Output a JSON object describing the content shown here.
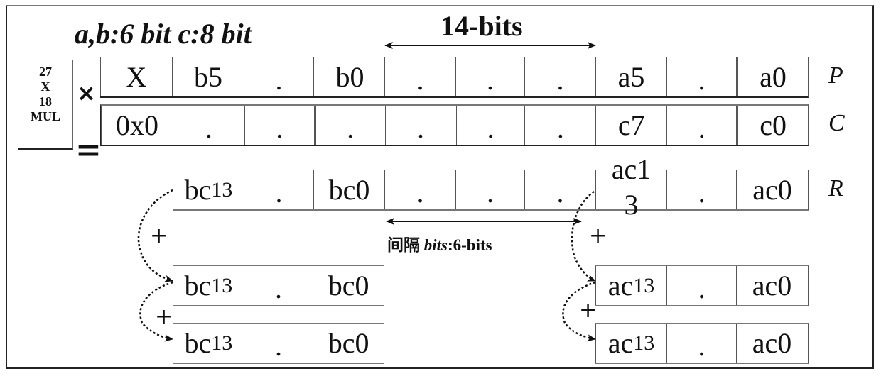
{
  "title": "a,b:6 bit c:8 bit",
  "span_label": "14-bits",
  "multiplier": {
    "lines": [
      "27",
      "X",
      "18",
      "MUL"
    ]
  },
  "operators": {
    "times": "×",
    "equals": "=",
    "plus": "+"
  },
  "rows": {
    "P": {
      "label": "P",
      "cells": [
        "X",
        "b5",
        ".",
        "b0",
        ".",
        ".",
        ".",
        "a5",
        ".",
        "a0"
      ]
    },
    "C": {
      "label": "C",
      "cells": [
        "0x0",
        ".",
        ".",
        ".",
        ".",
        ".",
        ".",
        "c7",
        ".",
        "c0"
      ]
    },
    "R": {
      "label": "R",
      "cells": [
        {
          "main": "bc",
          "sub": "13"
        },
        {
          "main": "."
        },
        {
          "main": "bc0"
        },
        {
          "main": "."
        },
        {
          "main": "."
        },
        {
          "main": "."
        },
        {
          "main": "ac1\n3"
        },
        {
          "main": "."
        },
        {
          "main": "ac0"
        }
      ]
    }
  },
  "gap_label": {
    "prefix": "间隔 ",
    "italic": "bits",
    "suffix": ":6-bits"
  },
  "partial_rows": {
    "bc": [
      {
        "cells": [
          {
            "main": "bc",
            "sub": "13"
          },
          {
            "main": "."
          },
          {
            "main": "bc0"
          }
        ]
      },
      {
        "cells": [
          {
            "main": "bc",
            "sub": "13"
          },
          {
            "main": "."
          },
          {
            "main": "bc0"
          }
        ]
      }
    ],
    "ac": [
      {
        "cells": [
          {
            "main": "ac",
            "sub": "13"
          },
          {
            "main": "."
          },
          {
            "main": "ac0"
          }
        ]
      },
      {
        "cells": [
          {
            "main": "ac",
            "sub": "13"
          },
          {
            "main": "."
          },
          {
            "main": "ac0"
          }
        ]
      }
    ]
  }
}
